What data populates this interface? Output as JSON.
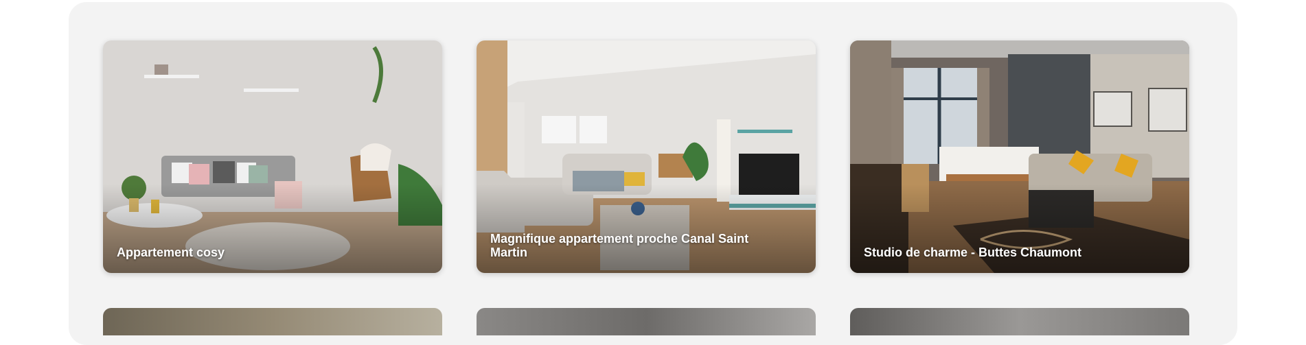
{
  "listings": [
    {
      "title": "Appartement cosy",
      "image": "living-room-grey-sofa-photo"
    },
    {
      "title": "Magnifique appartement proche Canal Saint Martin",
      "image": "living-room-sectional-sofa-photo"
    },
    {
      "title": "Studio de charme - Buttes Chaumont",
      "image": "studio-bedroom-lounge-photo"
    }
  ],
  "colors": {
    "panel": "#f3f3f3",
    "title_text": "#ffffff"
  }
}
